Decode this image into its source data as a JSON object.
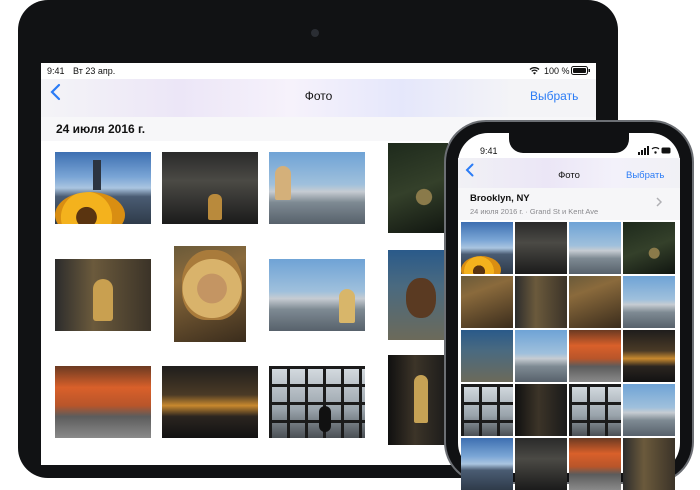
{
  "ipad": {
    "status": {
      "time": "9:41",
      "date": "Вт 23 апр.",
      "battery": "100 %",
      "wifi_icon": "wifi-icon",
      "battery_icon": "battery-icon"
    },
    "nav": {
      "back_icon": "chevron-left-icon",
      "title": "Фото",
      "select_label": "Выбрать"
    },
    "section_date": "24 июля 2016 г.",
    "photos": [
      "bridge-sunflower",
      "dark-doorway",
      "woman-skyline",
      "tree",
      "man-wall",
      "curly-hair-portrait",
      "city-waterfront",
      "man-portrait",
      "orange-building",
      "sunset-water",
      "window-silhouette",
      "corridor-figure"
    ]
  },
  "iphone": {
    "status": {
      "time": "9:41"
    },
    "nav": {
      "back_icon": "chevron-left-icon",
      "title": "Фото",
      "select_label": "Выбрать"
    },
    "location": {
      "title": "Brooklyn, NY",
      "subtitle": "24 июля 2016 г.  ·  Grand St и Kent Ave",
      "chevron_icon": "chevron-right-icon"
    },
    "tile_count": 24
  },
  "colors": {
    "accent": "#2b7cf6",
    "device": "#111214"
  }
}
